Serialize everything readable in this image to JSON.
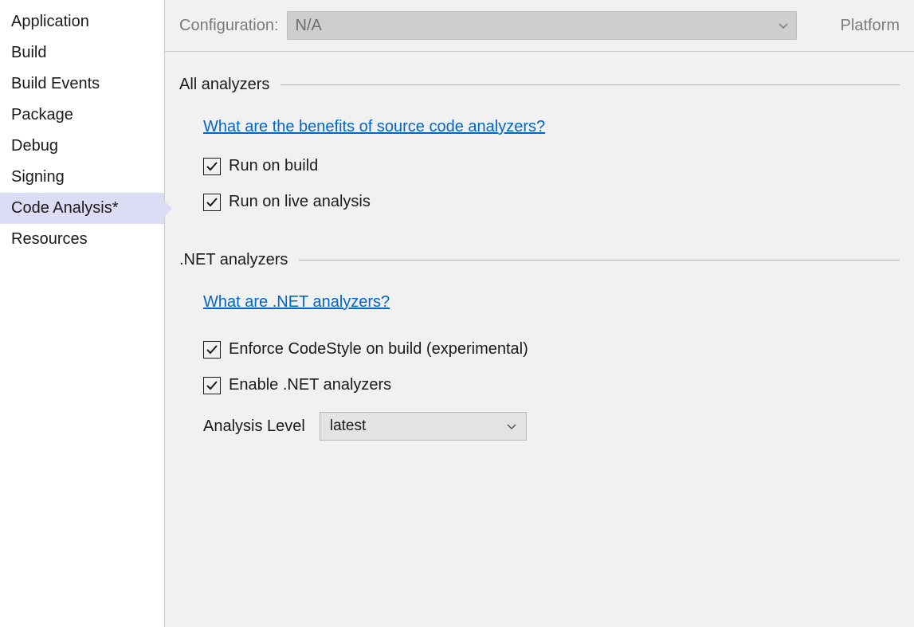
{
  "sidebar": {
    "items": [
      {
        "label": "Application",
        "selected": false
      },
      {
        "label": "Build",
        "selected": false
      },
      {
        "label": "Build Events",
        "selected": false
      },
      {
        "label": "Package",
        "selected": false
      },
      {
        "label": "Debug",
        "selected": false
      },
      {
        "label": "Signing",
        "selected": false
      },
      {
        "label": "Code Analysis*",
        "selected": true
      },
      {
        "label": "Resources",
        "selected": false
      }
    ]
  },
  "topbar": {
    "configuration_label": "Configuration:",
    "configuration_value": "N/A",
    "platform_label": "Platform"
  },
  "sections": {
    "all_analyzers": {
      "title": "All analyzers",
      "link": "What are the benefits of source code analyzers?",
      "checkboxes": [
        {
          "label": "Run on build",
          "checked": true
        },
        {
          "label": "Run on live analysis",
          "checked": true
        }
      ]
    },
    "net_analyzers": {
      "title": ".NET analyzers",
      "link": "What are .NET analyzers?",
      "checkboxes": [
        {
          "label": "Enforce CodeStyle on build (experimental)",
          "checked": true
        },
        {
          "label": "Enable .NET analyzers",
          "checked": true
        }
      ],
      "analysis_level_label": "Analysis Level",
      "analysis_level_value": "latest"
    }
  }
}
